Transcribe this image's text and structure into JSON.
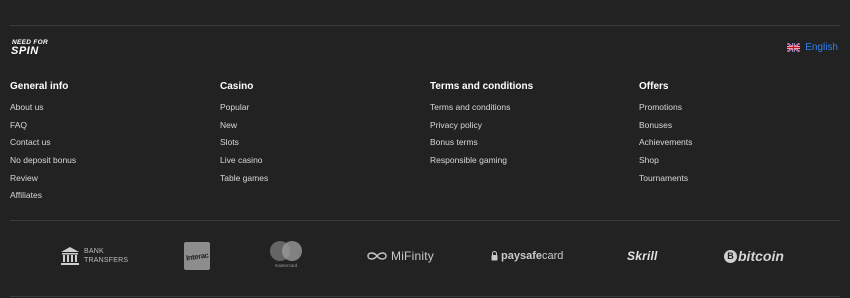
{
  "logo": {
    "line1": "NEED FOR",
    "line2": "SPIN"
  },
  "language": {
    "label": "English",
    "flag": "uk-flag-icon"
  },
  "columns": [
    {
      "title": "General info",
      "items": [
        "About us",
        "FAQ",
        "Contact us",
        "No deposit bonus",
        "Review",
        "Affiliates"
      ]
    },
    {
      "title": "Casino",
      "items": [
        "Popular",
        "New",
        "Slots",
        "Live casino",
        "Table games"
      ]
    },
    {
      "title": "Terms and conditions",
      "items": [
        "Terms and conditions",
        "Privacy policy",
        "Bonus terms",
        "Responsible gaming"
      ]
    },
    {
      "title": "Offers",
      "items": [
        "Promotions",
        "Bonuses",
        "Achievements",
        "Shop",
        "Tournaments"
      ]
    }
  ],
  "payments": {
    "bank": {
      "line1": "BANK",
      "line2": "TRANSFERS"
    },
    "interac": "Interac",
    "mastercard": "mastercard",
    "mifinity": "MiFinity",
    "paysafecard": {
      "bold": "paysafe",
      "light": "card"
    },
    "skrill": "Skrill",
    "bitcoin": "bitcoin",
    "bitcoin_symbol": "B"
  },
  "colors": {
    "background": "#222222",
    "accent": "#2f80ed",
    "divider": "#3a3a3a"
  }
}
